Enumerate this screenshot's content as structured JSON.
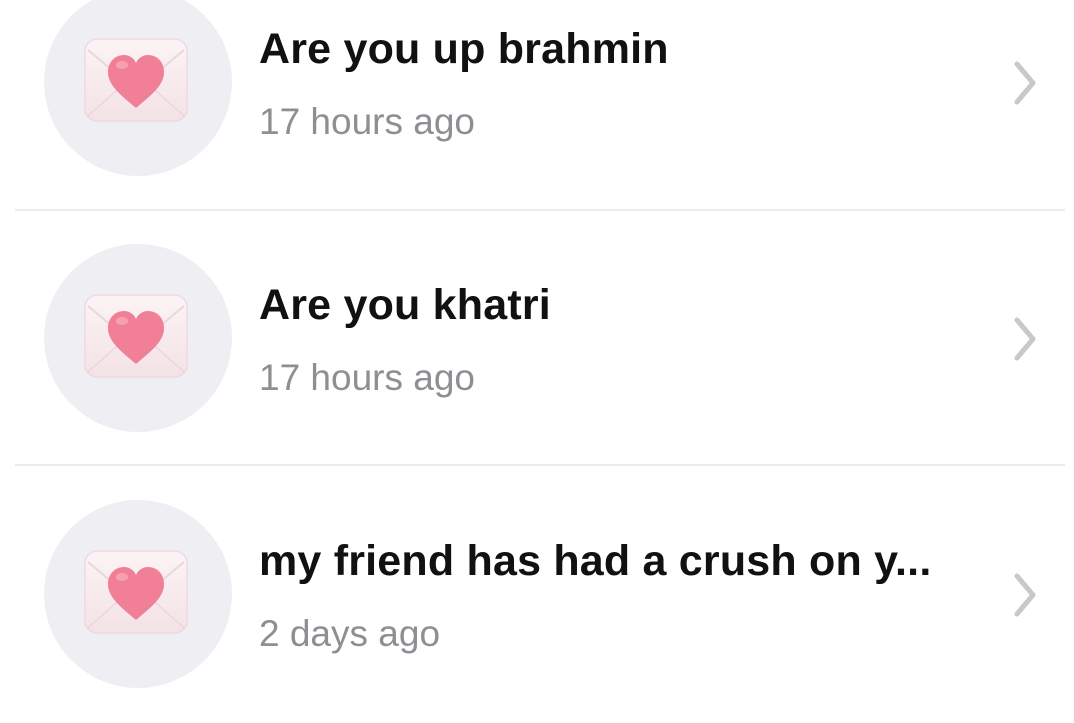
{
  "notifications": [
    {
      "title": "Are you up brahmin",
      "time": "17 hours ago",
      "icon": "heart-envelope-icon"
    },
    {
      "title": "Are you khatri",
      "time": "17 hours ago",
      "icon": "heart-envelope-icon"
    },
    {
      "title": "my friend has had a crush on y...",
      "time": "2 days ago",
      "icon": "heart-envelope-icon"
    }
  ],
  "colors": {
    "background": "#ffffff",
    "avatar_bg": "#efeff3",
    "title": "#111111",
    "timestamp": "#8e8e93",
    "chevron": "#c7c7cc",
    "heart": "#f07f97",
    "envelope": "#fbeff1",
    "divider": "#ececef"
  }
}
